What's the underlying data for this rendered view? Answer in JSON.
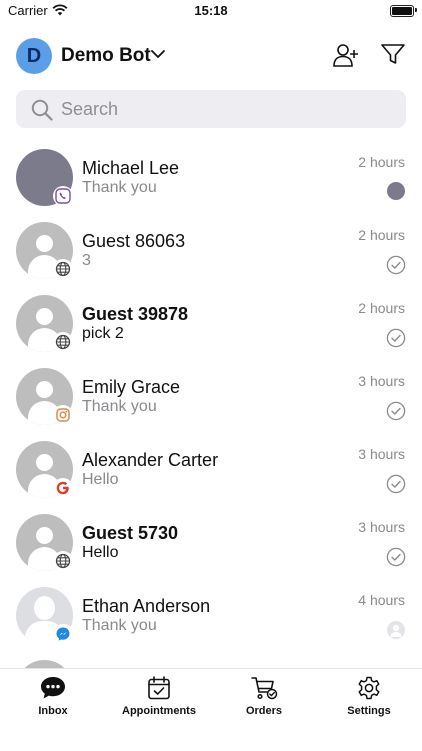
{
  "status_bar": {
    "carrier": "Carrier",
    "time": "15:18"
  },
  "header": {
    "avatar_letter": "D",
    "bot_name": "Demo Bot"
  },
  "search": {
    "placeholder": "Search"
  },
  "conversations": [
    {
      "name": "Michael Lee",
      "preview": "Thank you",
      "time": "2 hours",
      "channel": "viber-icon",
      "unread": true,
      "bold": false
    },
    {
      "name": "Guest 86063",
      "preview": "3",
      "time": "2 hours",
      "channel": "web-globe-icon",
      "unread": false,
      "bold": false
    },
    {
      "name": "Guest 39878",
      "preview": "pick 2",
      "time": "2 hours",
      "channel": "web-globe-icon",
      "unread": false,
      "bold": true
    },
    {
      "name": "Emily Grace",
      "preview": "Thank you",
      "time": "3 hours",
      "channel": "instagram-icon",
      "unread": false,
      "bold": false
    },
    {
      "name": "Alexander Carter",
      "preview": "Hello",
      "time": "3 hours",
      "channel": "google-icon",
      "unread": false,
      "bold": false
    },
    {
      "name": "Guest 5730",
      "preview": "Hello",
      "time": "3 hours",
      "channel": "web-globe-icon",
      "unread": false,
      "bold": true
    },
    {
      "name": "Ethan Anderson",
      "preview": "Thank you",
      "time": "4 hours",
      "channel": "messenger-icon",
      "unread": false,
      "bold": false
    }
  ],
  "tabs": [
    {
      "label": "Inbox",
      "icon": "chat-bubble-icon"
    },
    {
      "label": "Appointments",
      "icon": "calendar-check-icon"
    },
    {
      "label": "Orders",
      "icon": "cart-check-icon"
    },
    {
      "label": "Settings",
      "icon": "gear-icon"
    }
  ],
  "colors": {
    "bot_avatar": "#5b9ee8",
    "unread_dot": "#7c7b8c",
    "search_bg": "#eeeef2"
  }
}
